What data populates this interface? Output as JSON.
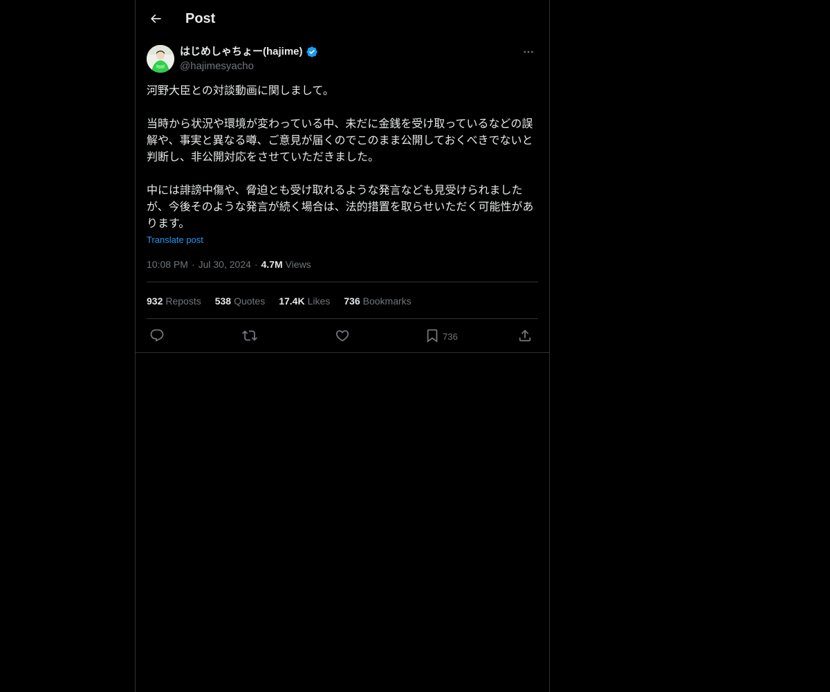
{
  "header": {
    "title": "Post"
  },
  "author": {
    "display_name": "はじめしゃちょー(hajime)",
    "handle": "@hajimesyacho",
    "verified": true,
    "verified_color": "#1d9bf0"
  },
  "post": {
    "paragraphs": [
      "河野大臣との対談動画に関しまして。",
      "当時から状況や環境が変わっている中、未だに金銭を受け取っているなどの誤解や、事実と異なる噂、ご意見が届くのでこのまま公開しておくべきでないと判断し、非公開対応をさせていただきました。",
      "中には誹謗中傷や、脅迫とも受け取れるような発言なども見受けられましたが、今後そのような発言が続く場合は、法的措置を取らせいただく可能性があります。"
    ],
    "translate_label": "Translate post",
    "time": "10:08 PM",
    "date": "Jul 30, 2024",
    "views_count": "4.7M",
    "views_label": "Views"
  },
  "stats": {
    "reposts_count": "932",
    "reposts_label": "Reposts",
    "quotes_count": "538",
    "quotes_label": "Quotes",
    "likes_count": "17.4K",
    "likes_label": "Likes",
    "bookmarks_count": "736",
    "bookmarks_label": "Bookmarks"
  },
  "actions": {
    "reply_icon": "reply-icon",
    "repost_icon": "repost-icon",
    "like_icon": "heart-icon",
    "bookmark_icon": "bookmark-icon",
    "bookmark_count": "736",
    "share_icon": "share-icon"
  },
  "colors": {
    "background": "#000000",
    "text_primary": "#e7e9ea",
    "text_secondary": "#71767b",
    "link": "#1d9bf0",
    "border": "#2f3336"
  }
}
